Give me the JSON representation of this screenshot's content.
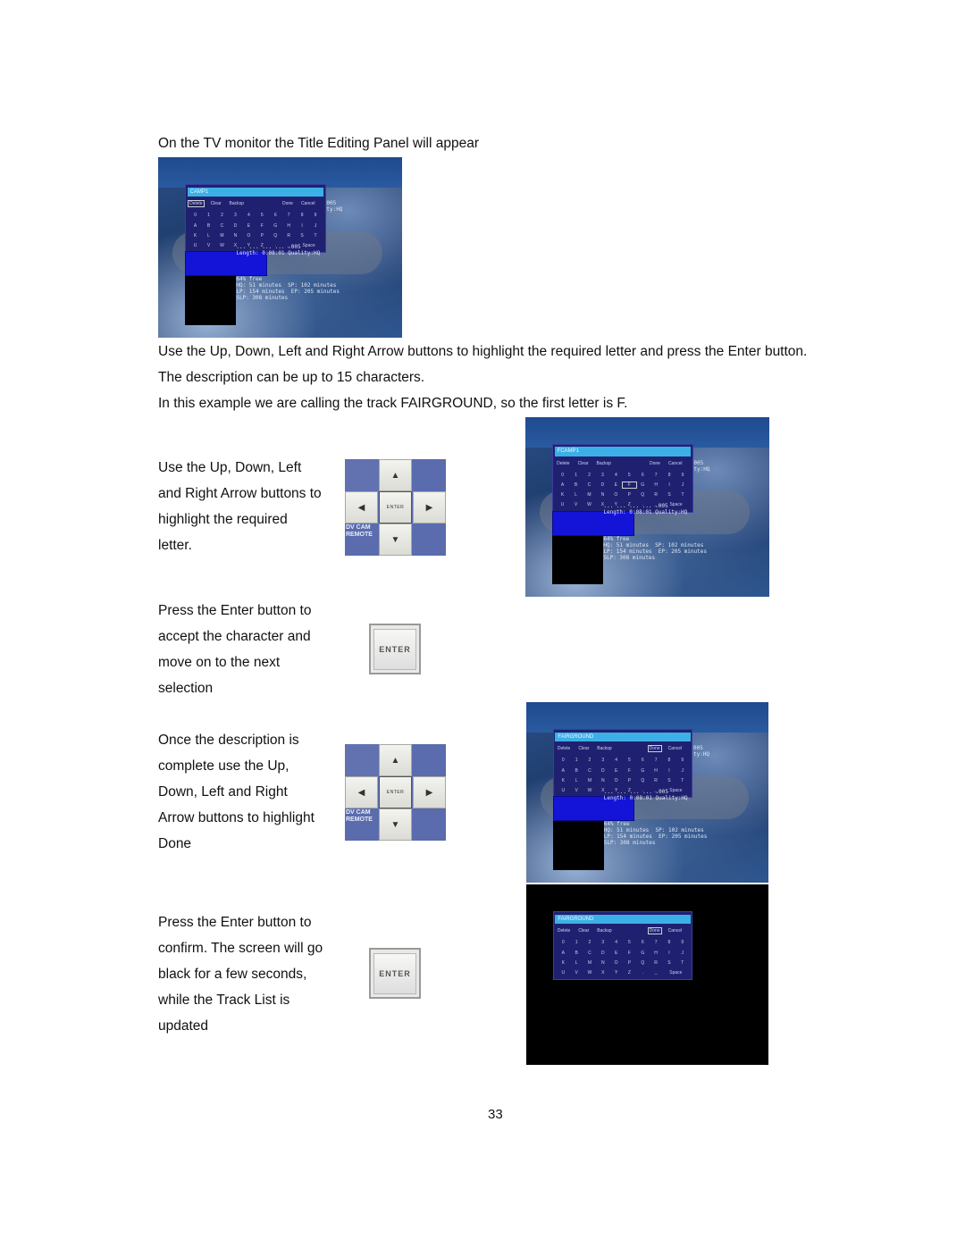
{
  "intro": "On the TV monitor the Title Editing Panel will appear",
  "instructions": [
    "Use the Up, Down, Left and Right Arrow buttons to highlight the required letter and press the Enter button.",
    "The description can be up to 15 characters.",
    "In this example we are calling the track FAIRGROUND, so the first letter is F."
  ],
  "steps": [
    {
      "lines": [
        "Use the Up, Down, Left",
        "and Right Arrow buttons to",
        "highlight the required",
        "letter."
      ]
    },
    {
      "lines": [
        "Press the Enter button to",
        "accept the character and",
        "move on to the next",
        "selection"
      ]
    },
    {
      "lines": [
        "Once the description is",
        "complete use the Up,",
        "Down, Left and Right",
        "Arrow buttons to highlight",
        "Done"
      ]
    },
    {
      "lines": [
        "Press the Enter button to",
        "confirm. The screen will go",
        "black for a few seconds,",
        "while the Track List is",
        "updated"
      ]
    }
  ],
  "remote": {
    "up": "▲",
    "down": "▼",
    "left": "◀",
    "right": "▶",
    "enter": "ENTER",
    "brand": [
      "DV CAM",
      "REMOTE"
    ]
  },
  "enter_button": {
    "label": "ENTER"
  },
  "panel": {
    "controls": [
      "Delete",
      "Clear",
      "Backsp",
      "Done",
      "Cancel"
    ],
    "rows": [
      [
        "0",
        "1",
        "2",
        "3",
        "4",
        "5",
        "6",
        "7",
        "8",
        "9"
      ],
      [
        "A",
        "B",
        "C",
        "D",
        "E",
        "F",
        "G",
        "H",
        "I",
        "J"
      ],
      [
        "K",
        "L",
        "M",
        "N",
        "O",
        "P",
        "Q",
        "R",
        "S",
        "T"
      ],
      [
        "U",
        "V",
        "W",
        "X",
        "Y",
        "Z",
        ".",
        "_",
        "Space"
      ]
    ],
    "side": [
      "005",
      "ty:HQ"
    ],
    "date_line": "... ... ... ... .005",
    "length_line": "Length: 0:08:01 Quality:HQ",
    "free": {
      "pct": "64% free",
      "hq": "HQ:  51 minutes",
      "sp": "SP:  102 minutes",
      "lp": "LP:  154 minutes",
      "ep": "EP:  205 minutes",
      "slp": "SLP: 308 minutes"
    }
  },
  "screens": [
    {
      "title": "CAMP1",
      "selected": "Delete"
    },
    {
      "title": "FCAMP1",
      "selected": "F"
    },
    {
      "title": "FAIRGROUND",
      "selected": "Done"
    },
    {
      "title": "FAIRGROUND",
      "selected": "Done"
    }
  ],
  "page_number": "33"
}
